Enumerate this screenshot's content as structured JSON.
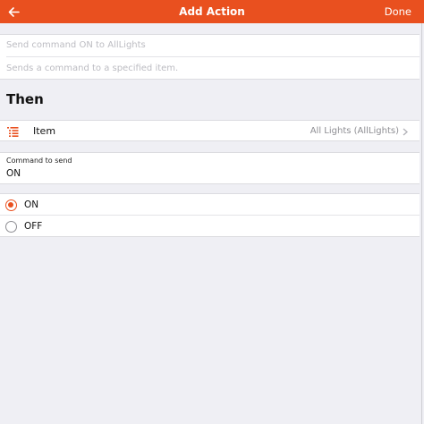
{
  "header": {
    "back_icon": "arrow-left-icon",
    "title": "Add Action",
    "done_label": "Done",
    "accent_color": "#e9501f"
  },
  "description": {
    "label_placeholder": "Send command ON to AllLights",
    "description_placeholder": "Sends a command to a specified item."
  },
  "then_section": {
    "heading": "Then",
    "item_row": {
      "icon": "list-icon",
      "label": "Item",
      "value": "All Lights (AllLights)"
    },
    "command": {
      "label": "Command to send",
      "value": "ON"
    },
    "options": [
      {
        "label": "ON",
        "selected": true
      },
      {
        "label": "OFF",
        "selected": false
      }
    ]
  }
}
